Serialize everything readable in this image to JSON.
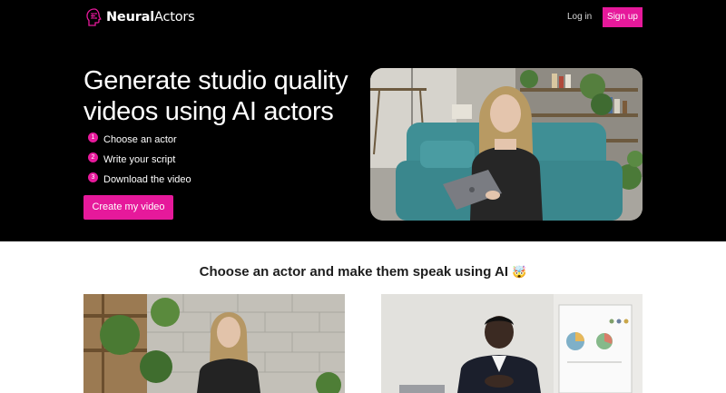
{
  "header": {
    "logo_text_bold": "Neural",
    "logo_text_regular": "Actors",
    "login_label": "Log in",
    "signup_label": "Sign up"
  },
  "hero": {
    "headline": "Generate studio quality videos using AI actors",
    "steps": [
      {
        "number": "1",
        "label": "Choose an actor"
      },
      {
        "number": "2",
        "label": "Write your script"
      },
      {
        "number": "3",
        "label": "Download the video"
      }
    ],
    "cta_label": "Create my video"
  },
  "actors_section": {
    "title": "Choose an actor and make them speak using AI",
    "title_emoji": "🤯"
  },
  "colors": {
    "accent": "#e6199b",
    "hero_background": "#000000",
    "page_background": "#ffffff"
  },
  "icons": {
    "logo": "brain-head-icon"
  }
}
